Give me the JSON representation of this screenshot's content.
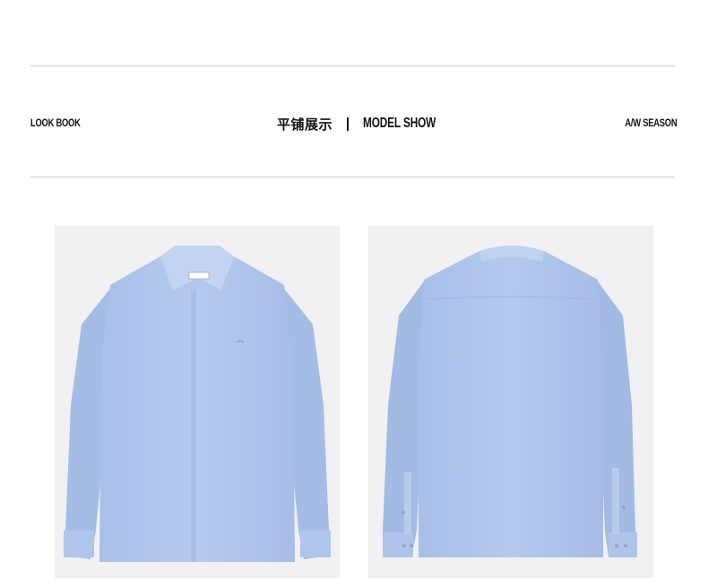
{
  "header": {
    "left_label": "LOOK BOOK",
    "title_cn": "平铺展示",
    "title_en": "MODEL SHOW",
    "right_label": "A/W SEASON"
  },
  "photos": [
    {
      "view": "front",
      "subject": "light blue long-sleeve shirt"
    },
    {
      "view": "back",
      "subject": "light blue long-sleeve shirt"
    }
  ],
  "colors": {
    "shirt": "#b3c8ec",
    "shirt_shadow": "#9fb6e0",
    "photo_background": "#f1f1f3",
    "rule": "#cfcfcf"
  }
}
